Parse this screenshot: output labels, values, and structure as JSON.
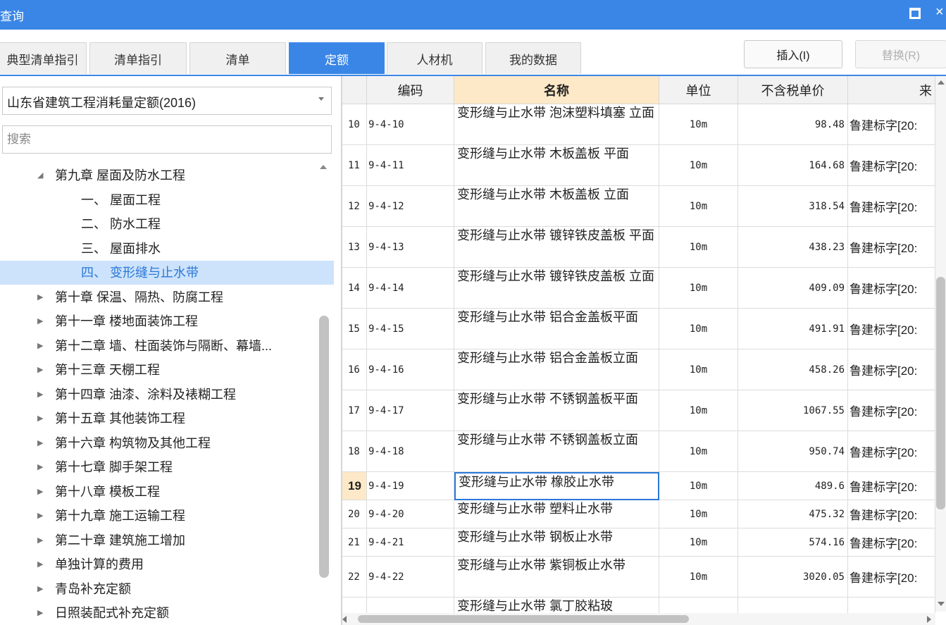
{
  "window": {
    "title": "查询",
    "maximize_icon": "maximize-icon",
    "close_icon": "close-icon",
    "close_glyph": "×"
  },
  "tabs": [
    {
      "label": "典型清单指引",
      "active": false
    },
    {
      "label": "清单指引",
      "active": false
    },
    {
      "label": "清单",
      "active": false
    },
    {
      "label": "定额",
      "active": true
    },
    {
      "label": "人材机",
      "active": false
    },
    {
      "label": "我的数据",
      "active": false
    }
  ],
  "actions": {
    "insert_label": "插入(I)",
    "replace_label": "替换(R)",
    "replace_disabled": true
  },
  "left_panel": {
    "quota_library": "山东省建筑工程消耗量定额(2016)",
    "search_placeholder": "搜索",
    "search_value": "",
    "tree": [
      {
        "label": "第九章 屋面及防水工程",
        "level": 1,
        "expanded": true,
        "caret": "◢"
      },
      {
        "label": "一、 屋面工程",
        "level": 2
      },
      {
        "label": "二、 防水工程",
        "level": 2
      },
      {
        "label": "三、 屋面排水",
        "level": 2
      },
      {
        "label": "四、 变形缝与止水带",
        "level": 2,
        "selected": true
      },
      {
        "label": "第十章 保温、隔热、防腐工程",
        "level": 1,
        "caret": "▶"
      },
      {
        "label": "第十一章 楼地面装饰工程",
        "level": 1,
        "caret": "▶"
      },
      {
        "label": "第十二章 墙、柱面装饰与隔断、幕墙...",
        "level": 1,
        "caret": "▶"
      },
      {
        "label": "第十三章 天棚工程",
        "level": 1,
        "caret": "▶"
      },
      {
        "label": "第十四章 油漆、涂料及裱糊工程",
        "level": 1,
        "caret": "▶"
      },
      {
        "label": "第十五章 其他装饰工程",
        "level": 1,
        "caret": "▶"
      },
      {
        "label": "第十六章 构筑物及其他工程",
        "level": 1,
        "caret": "▶"
      },
      {
        "label": "第十七章 脚手架工程",
        "level": 1,
        "caret": "▶"
      },
      {
        "label": "第十八章 模板工程",
        "level": 1,
        "caret": "▶"
      },
      {
        "label": "第十九章 施工运输工程",
        "level": 1,
        "caret": "▶"
      },
      {
        "label": "第二十章 建筑施工增加",
        "level": 1,
        "caret": "▶"
      },
      {
        "label": "单独计算的费用",
        "level": 1,
        "caret": "▶"
      },
      {
        "label": "青岛补充定额",
        "level": 1,
        "caret": "▶"
      },
      {
        "label": "日照装配式补充定额",
        "level": 1,
        "caret": "▶"
      }
    ]
  },
  "grid": {
    "columns": {
      "rownum": "",
      "code": "编码",
      "name": "名称",
      "unit": "单位",
      "price": "不含税单价",
      "source": "来"
    },
    "rows": [
      {
        "n": "10",
        "code": "9-4-10",
        "name": "变形缝与止水带 泡沫塑料填塞 立面",
        "unit": "10m",
        "price": "98.48",
        "source": "鲁建标字[20:"
      },
      {
        "n": "11",
        "code": "9-4-11",
        "name": "变形缝与止水带 木板盖板 平面",
        "unit": "10m",
        "price": "164.68",
        "source": "鲁建标字[20:"
      },
      {
        "n": "12",
        "code": "9-4-12",
        "name": "变形缝与止水带 木板盖板 立面",
        "unit": "10m",
        "price": "318.54",
        "source": "鲁建标字[20:"
      },
      {
        "n": "13",
        "code": "9-4-13",
        "name": "变形缝与止水带 镀锌铁皮盖板 平面",
        "unit": "10m",
        "price": "438.23",
        "source": "鲁建标字[20:"
      },
      {
        "n": "14",
        "code": "9-4-14",
        "name": "变形缝与止水带 镀锌铁皮盖板 立面",
        "unit": "10m",
        "price": "409.09",
        "source": "鲁建标字[20:"
      },
      {
        "n": "15",
        "code": "9-4-15",
        "name": "变形缝与止水带 铝合金盖板平面",
        "unit": "10m",
        "price": "491.91",
        "source": "鲁建标字[20:"
      },
      {
        "n": "16",
        "code": "9-4-16",
        "name": "变形缝与止水带 铝合金盖板立面",
        "unit": "10m",
        "price": "458.26",
        "source": "鲁建标字[20:"
      },
      {
        "n": "17",
        "code": "9-4-17",
        "name": "变形缝与止水带 不锈钢盖板平面",
        "unit": "10m",
        "price": "1067.55",
        "source": "鲁建标字[20:"
      },
      {
        "n": "18",
        "code": "9-4-18",
        "name": "变形缝与止水带 不锈钢盖板立面",
        "unit": "10m",
        "price": "950.74",
        "source": "鲁建标字[20:"
      },
      {
        "n": "19",
        "code": "9-4-19",
        "name": "变形缝与止水带 橡胶止水带",
        "unit": "10m",
        "price": "489.6",
        "source": "鲁建标字[20:",
        "current": true
      },
      {
        "n": "20",
        "code": "9-4-20",
        "name": "变形缝与止水带 塑料止水带",
        "unit": "10m",
        "price": "475.32",
        "source": "鲁建标字[20:"
      },
      {
        "n": "21",
        "code": "9-4-21",
        "name": "变形缝与止水带 钢板止水带",
        "unit": "10m",
        "price": "574.16",
        "source": "鲁建标字[20:"
      },
      {
        "n": "22",
        "code": "9-4-22",
        "name": "变形缝与止水带 紫铜板止水带",
        "unit": "10m",
        "price": "3020.05",
        "source": "鲁建标字[20:"
      },
      {
        "n": "",
        "code": "",
        "name": "变形缝与止水带 氯丁胶粘玻",
        "unit": "",
        "price": "",
        "source": ""
      }
    ]
  },
  "colors": {
    "accent": "#3a86e6",
    "selected_tree_bg": "#cde3fb",
    "sorted_header_bg": "#fde9c8",
    "current_cell_border": "#2b78d8"
  }
}
